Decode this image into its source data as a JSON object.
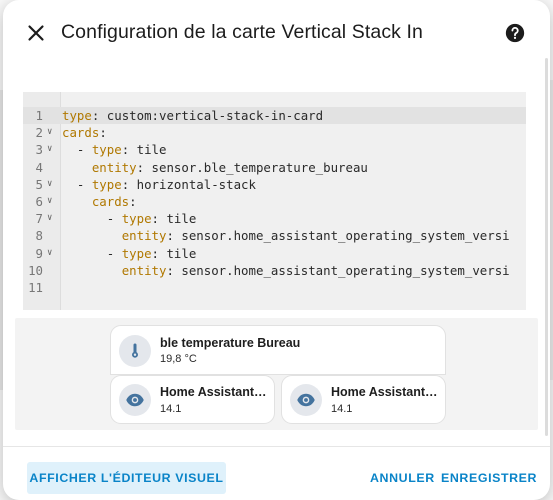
{
  "dialog": {
    "title": "Configuration de la carte Vertical Stack In",
    "close_icon": "close-icon",
    "help_icon": "help-circle-icon"
  },
  "editor": {
    "lines": [
      {
        "num": "1",
        "fold": "",
        "key": "type",
        "indent": "",
        "dash": "",
        "value": " custom:vertical-stack-in-card"
      },
      {
        "num": "2",
        "fold": "v",
        "key": "cards",
        "indent": "",
        "dash": "",
        "value": ""
      },
      {
        "num": "3",
        "fold": "v",
        "key": "type",
        "indent": "  ",
        "dash": "- ",
        "value": " tile"
      },
      {
        "num": "4",
        "fold": "",
        "key": "entity",
        "indent": "    ",
        "dash": "",
        "value": " sensor.ble_temperature_bureau"
      },
      {
        "num": "5",
        "fold": "v",
        "key": "type",
        "indent": "  ",
        "dash": "- ",
        "value": " horizontal-stack"
      },
      {
        "num": "6",
        "fold": "v",
        "key": "cards",
        "indent": "    ",
        "dash": "",
        "value": ""
      },
      {
        "num": "7",
        "fold": "v",
        "key": "type",
        "indent": "      ",
        "dash": "- ",
        "value": " tile"
      },
      {
        "num": "8",
        "fold": "",
        "key": "entity",
        "indent": "        ",
        "dash": "",
        "value": " sensor.home_assistant_operating_system_versi"
      },
      {
        "num": "9",
        "fold": "v",
        "key": "type",
        "indent": "      ",
        "dash": "- ",
        "value": " tile"
      },
      {
        "num": "10",
        "fold": "",
        "key": "entity",
        "indent": "        ",
        "dash": "",
        "value": " sensor.home_assistant_operating_system_versi"
      },
      {
        "num": "11",
        "fold": "",
        "key": "",
        "indent": "",
        "dash": "",
        "value": ""
      }
    ]
  },
  "preview": {
    "top_tile": {
      "name": "ble temperature Bureau",
      "state": "19,8 °C",
      "icon": "thermometer-icon"
    },
    "tile_a": {
      "name": "Home Assistant Operating System Version",
      "state": "14.1",
      "icon": "eye-icon"
    },
    "tile_b": {
      "name": "Home Assistant Operating System Version",
      "state": "14.1",
      "icon": "eye-icon"
    }
  },
  "footer": {
    "visual_editor_label": "AFFICHER L'ÉDITEUR VISUEL",
    "cancel_label": "ANNULER",
    "save_label": "ENREGISTRER"
  },
  "colors": {
    "accent": "#0a84c8",
    "yaml_key": "#b07800",
    "icon": "#44739e"
  }
}
